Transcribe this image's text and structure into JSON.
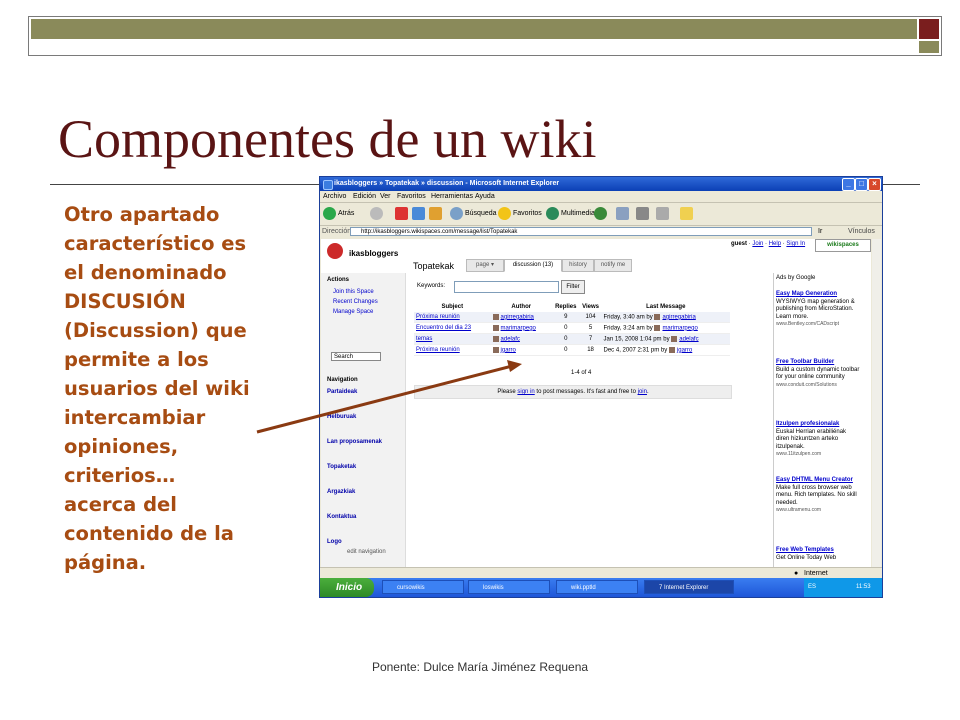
{
  "slide": {
    "title": "Componentes de un wiki",
    "body_lines": [
      "Otro apartado",
      "característico es",
      "el denominado",
      "DISCUSIÓN",
      "(Discussion) que",
      "permite a los",
      "usuarios del wiki",
      "intercambiar",
      "opiniones,",
      "criterios…",
      "acerca del",
      "contenido de la",
      "página."
    ],
    "footer": "Ponente: Dulce María Jiménez Requena",
    "colors": {
      "title": "#5a1414",
      "body": "#a74c12",
      "arrow": "#8a3a12",
      "olive": "#8a8a5a",
      "maroon": "#7a1e1e"
    }
  },
  "browser": {
    "title": "ikasbloggers » Topatekak » discussion - Microsoft Internet Explorer",
    "menu": [
      "Archivo",
      "Edición",
      "Ver",
      "Favoritos",
      "Herramientas",
      "Ayuda"
    ],
    "toolbar": {
      "back": "Atrás",
      "search": "Búsqueda",
      "favorites": "Favoritos",
      "multimedia": "Multimedia"
    },
    "address_label": "Dirección",
    "address": "http://ikasbloggers.wikispaces.com/message/list/Topatekak",
    "go": "Ir",
    "links": "Vínculos",
    "status": "Internet"
  },
  "site": {
    "name": "ikasbloggers",
    "user_links": {
      "guest": "guest",
      "join": "Join",
      "help": "Help",
      "signin": "Sign In"
    },
    "badge": "wikispaces",
    "actions_heading": "Actions",
    "actions": [
      "Join this Space",
      "Recent Changes",
      "Manage Space"
    ],
    "search_placeholder": "Search",
    "navigation_heading": "Navigation",
    "nav": [
      "Partaideak",
      "Helburuak",
      "Lan proposamenak",
      "Topaketak",
      "Argazkiak",
      "Kontaktua",
      "Logo"
    ],
    "edit_navigation": "edit navigation"
  },
  "main": {
    "page_title": "Topatekak",
    "tabs": [
      "page ▾",
      "discussion (13)",
      "history",
      "notify me"
    ],
    "keywords_label": "Keywords:",
    "filter_button": "Filter",
    "columns": [
      "Subject",
      "Author",
      "Replies",
      "Views",
      "Last Message"
    ],
    "rows": [
      {
        "subject": "Próxima reunión",
        "author": "agirregabiria",
        "replies": "9",
        "views": "104",
        "last": "Friday, 3:40 am by",
        "last_by": "agirregabiria"
      },
      {
        "subject": "Encuentro del dia 23",
        "author": "marimarpego",
        "replies": "0",
        "views": "5",
        "last": "Friday, 3:24 am by",
        "last_by": "marimarpego"
      },
      {
        "subject": "temas",
        "author": "adelafc",
        "replies": "0",
        "views": "7",
        "last": "Jan 15, 2008 1:04 pm by",
        "last_by": "adelafc"
      },
      {
        "subject": "Próxima reunión",
        "author": "jgarro",
        "replies": "0",
        "views": "18",
        "last": "Dec 4, 2007 2:31 pm by",
        "last_by": "jgarro"
      }
    ],
    "pager": "1-4 of 4",
    "please_prefix": "Please",
    "please_signin": "sign in",
    "please_mid": "to post messages. It's fast and free to",
    "please_join": "join",
    "please_end": "."
  },
  "ads": {
    "by": "Ads by Google",
    "items": [
      {
        "title": "Easy Map Generation",
        "text": "WYSIWYG map generation & publishing from MicroStation. Learn more.",
        "url": "www.Bentley.com/CADscript"
      },
      {
        "title": "Free Toolbar Builder",
        "text": "Build a custom dynamic toolbar for your online community",
        "url": "www.conduit.com/Solutions"
      },
      {
        "title": "Itzulpen profesionalak",
        "text": "Euskal Herrian erabiliénak diren hizkuntzen arteko itzulpenak.",
        "url": "www.11itzulpen.com"
      },
      {
        "title": "Easy DHTML Menu Creator",
        "text": "Make full cross browser web menu. Rich templates. No skill needed.",
        "url": "www.ultramenu.com"
      },
      {
        "title": "Free Web Templates",
        "text": "Get Online Today Web",
        "url": ""
      }
    ]
  },
  "taskbar": {
    "start": "Inicio",
    "tasks": [
      "cursowikis",
      "loswikis",
      "wiki.pptld",
      "7 Internet Explorer"
    ],
    "lang": "ES",
    "clock": "11:53"
  }
}
